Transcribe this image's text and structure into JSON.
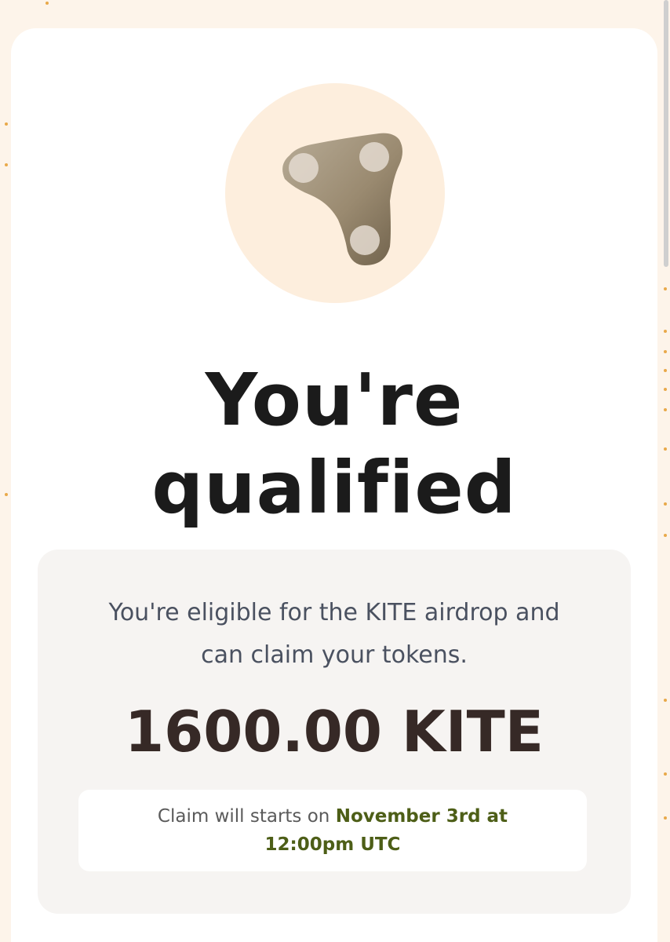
{
  "app": {
    "logo_icon": "kite-logo-icon"
  },
  "hero": {
    "title_line1": "You're",
    "title_line2": "qualified"
  },
  "eligibility": {
    "message": "You're eligible for the KITE airdrop and can claim your tokens.",
    "amount": "1600.00 KITE"
  },
  "claim": {
    "prefix": "Claim will starts on",
    "date_line1": "November 3rd at",
    "date_line2": "12:00pm UTC"
  },
  "colors": {
    "page_background": "#fdf4ea",
    "logo_circle": "#fdeedd",
    "heading_text": "#1b1b1b",
    "amount_text": "#362926",
    "claim_date": "#4d5e17",
    "info_box": "#f6f4f2"
  }
}
